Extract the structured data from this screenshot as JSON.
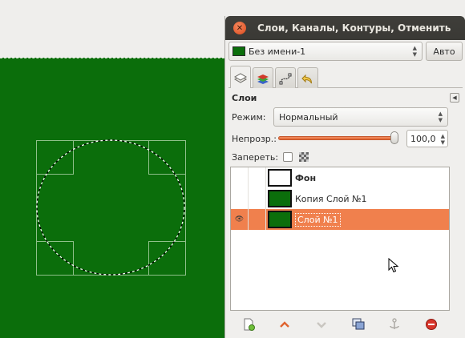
{
  "canvas": {
    "fill_color": "#0b6e0b"
  },
  "dock": {
    "title": "Слои, Каналы, Контуры, Отменить",
    "close_icon": "close-icon",
    "image_select": {
      "value": "Без имени-1"
    },
    "auto_button": "Авто",
    "tabs": [
      {
        "icon": "layers-icon"
      },
      {
        "icon": "channels-icon"
      },
      {
        "icon": "paths-icon"
      },
      {
        "icon": "undo-icon"
      }
    ]
  },
  "layers_panel": {
    "title": "Слои",
    "mode_label": "Режим:",
    "mode_value": "Нормальный",
    "opacity_label": "Непрозр.:",
    "opacity_value": "100,0",
    "opacity_percent": 100,
    "lock_label": "Запереть:",
    "layers": [
      {
        "name": "Фон",
        "thumb": "white",
        "visible": false,
        "selected": false
      },
      {
        "name": "Копия Слой №1",
        "thumb": "green",
        "visible": false,
        "selected": false
      },
      {
        "name": "Слой №1",
        "thumb": "green",
        "visible": true,
        "selected": true
      }
    ],
    "selection_color": "#f0804d",
    "bottom_buttons": [
      {
        "icon": "new-layer-icon"
      },
      {
        "icon": "raise-layer-icon"
      },
      {
        "icon": "lower-layer-icon"
      },
      {
        "icon": "duplicate-layer-icon"
      },
      {
        "icon": "anchor-layer-icon"
      },
      {
        "icon": "delete-layer-icon"
      }
    ]
  }
}
